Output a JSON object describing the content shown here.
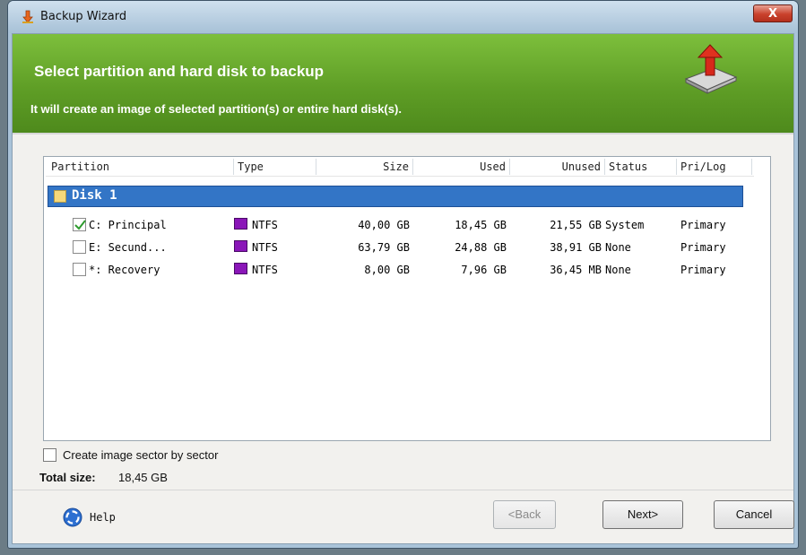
{
  "window": {
    "title": "Backup Wizard",
    "close_label": "X"
  },
  "banner": {
    "title": "Select partition and hard disk to backup",
    "subtitle": "It will create an image of selected partition(s) or entire hard disk(s).",
    "icon": "backup-drive-icon"
  },
  "table": {
    "columns": [
      "Partition",
      "Type",
      "Size",
      "Used",
      "Unused",
      "Status",
      "Pri/Log"
    ],
    "disk": {
      "label": "Disk 1",
      "checked": false
    },
    "rows": [
      {
        "partition": "C: Principal",
        "type": "NTFS",
        "size": "40,00 GB",
        "used": "18,45 GB",
        "unused": "21,55 GB",
        "status": "System",
        "prilog": "Primary",
        "checked": true
      },
      {
        "partition": "E: Secund...",
        "type": "NTFS",
        "size": "63,79 GB",
        "used": "24,88 GB",
        "unused": "38,91 GB",
        "status": "None",
        "prilog": "Primary",
        "checked": false
      },
      {
        "partition": "*: Recovery",
        "type": "NTFS",
        "size": "8,00 GB",
        "used": "7,96 GB",
        "unused": "36,45 MB",
        "status": "None",
        "prilog": "Primary",
        "checked": false
      }
    ]
  },
  "options": {
    "sector_label": "Create image sector by sector",
    "sector_checked": false,
    "total_label": "Total size:",
    "total_value": "18,45 GB"
  },
  "footer": {
    "help_label": "Help",
    "back_label": "<Back",
    "next_label": "Next>",
    "cancel_label": "Cancel"
  },
  "colors": {
    "banner_green": "#5f9e26",
    "selection_blue": "#3375c6",
    "ntfs_swatch": "#8a16b8"
  }
}
